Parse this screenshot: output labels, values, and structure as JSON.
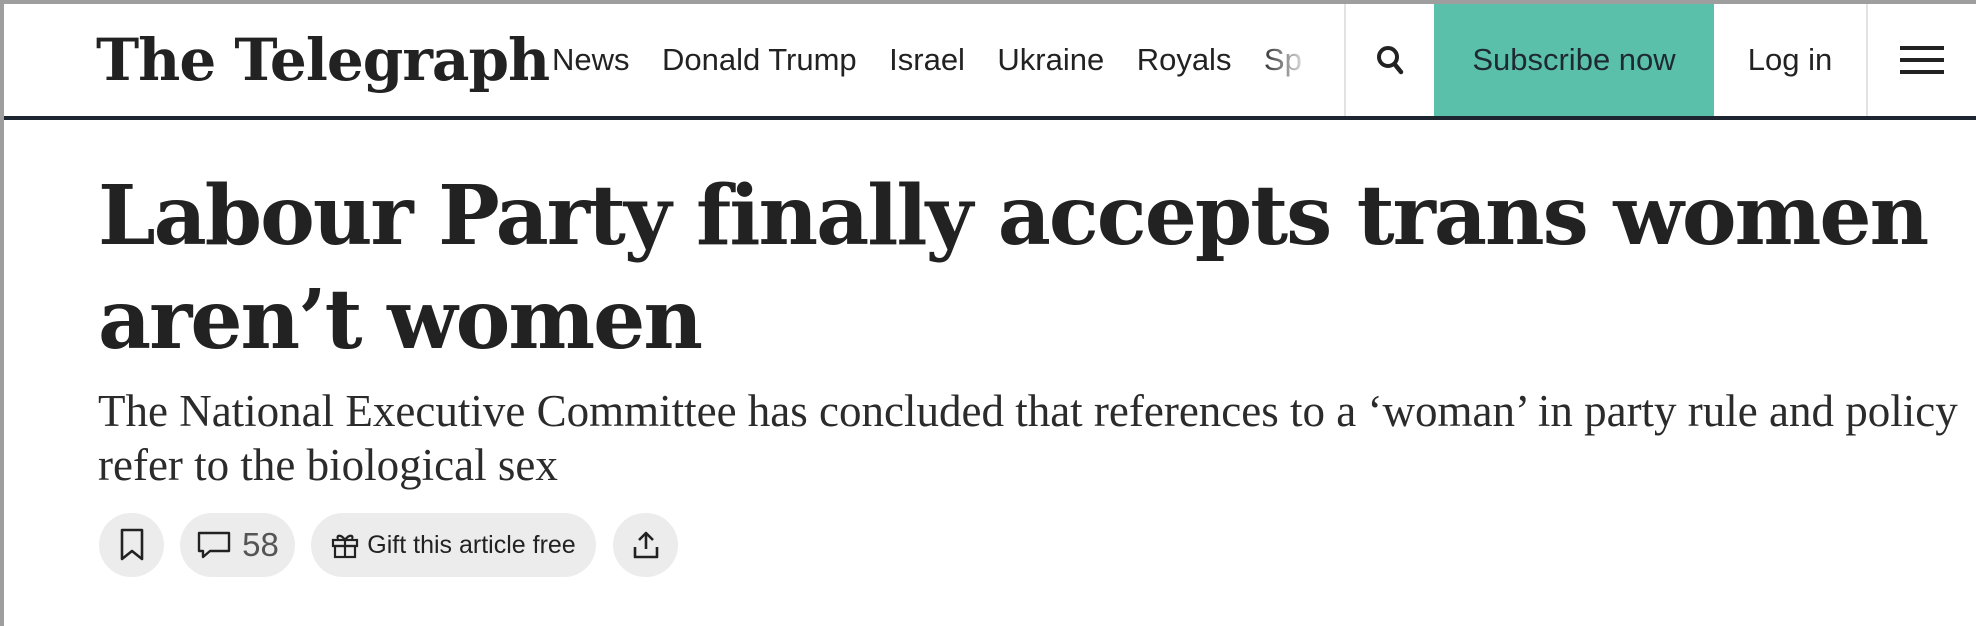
{
  "header": {
    "logo_text": "The Telegraph",
    "nav_items": [
      "News",
      "Donald Trump",
      "Israel",
      "Ukraine",
      "Royals",
      "Sp"
    ],
    "subscribe_label": "Subscribe now",
    "login_label": "Log in",
    "icons": [
      "search-icon",
      "hamburger-menu-icon"
    ]
  },
  "article": {
    "headline": "Labour Party finally accepts trans women aren’t women",
    "standfirst": "The National Executive Committee has concluded that references to a ‘woman’ in party rule and policy refer to the biological sex"
  },
  "actions": {
    "comment_count": "58",
    "gift_label": "Gift this article free",
    "icons": [
      "bookmark-icon",
      "comment-icon",
      "gift-icon",
      "share-icon"
    ]
  },
  "colors": {
    "subscribe_bg": "#5bc0a9",
    "header_rule": "#1d2530",
    "pill_bg": "#ececec",
    "text": "#222222"
  }
}
